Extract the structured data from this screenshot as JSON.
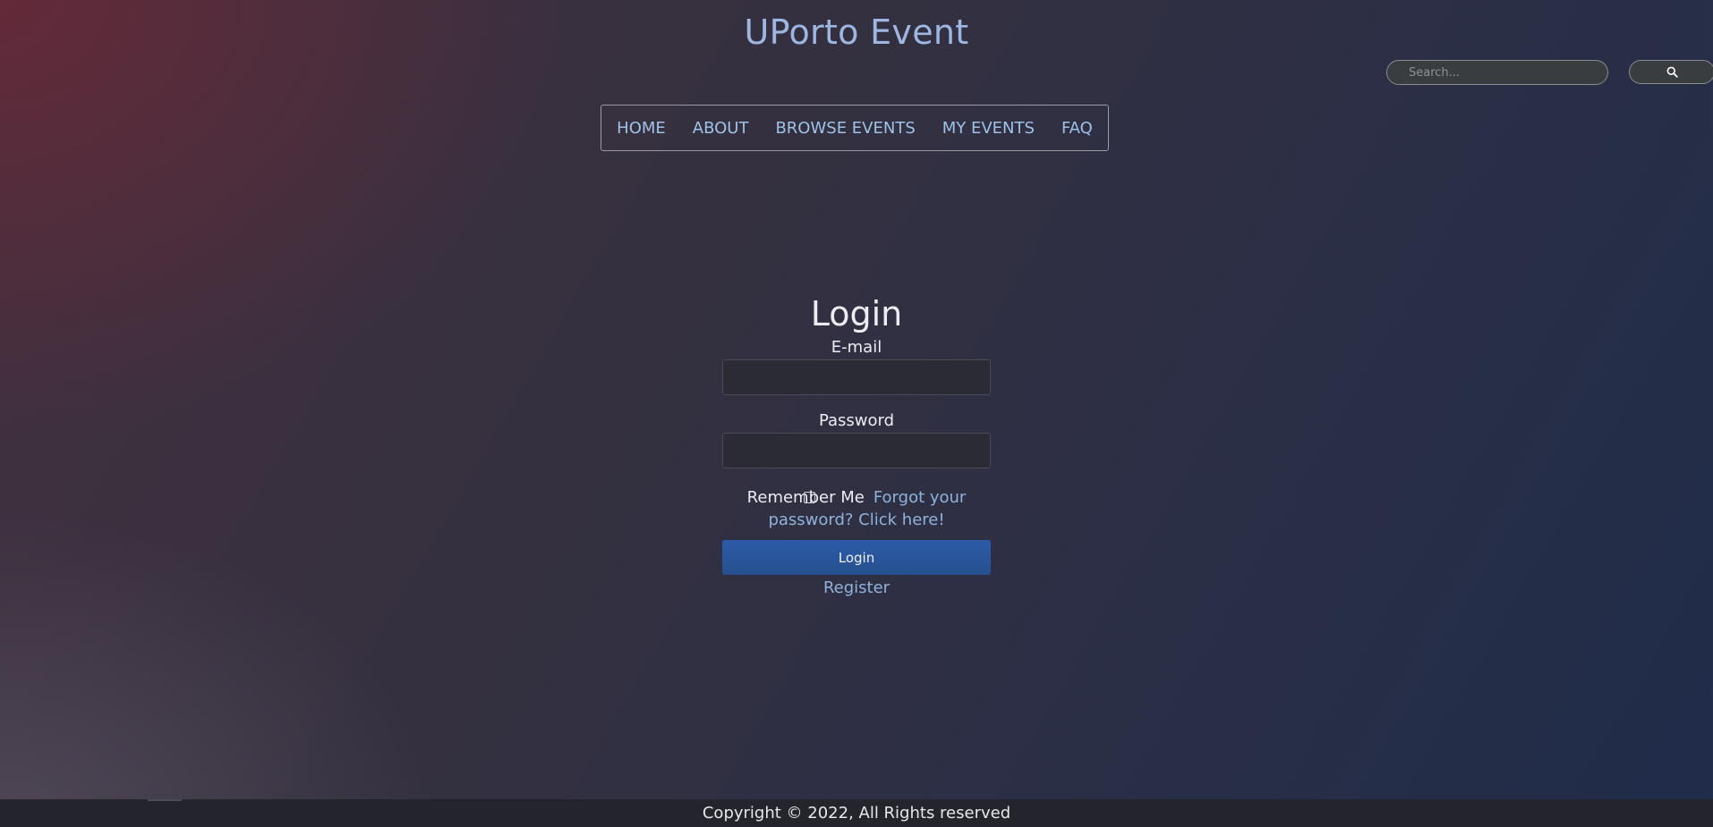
{
  "header": {
    "title": "UPorto Event"
  },
  "search": {
    "placeholder": "Search...",
    "icon": "search-icon"
  },
  "nav": {
    "items": [
      {
        "label": "HOME"
      },
      {
        "label": "ABOUT"
      },
      {
        "label": "BROWSE EVENTS"
      },
      {
        "label": "MY EVENTS"
      },
      {
        "label": "FAQ"
      }
    ]
  },
  "login": {
    "heading": "Login",
    "email_label": "E-mail",
    "email_value": "",
    "password_label": "Password",
    "password_value": "",
    "remember_checked": false,
    "remember_label": "Remember Me",
    "forgot_link": "Forgot your password? Click here!",
    "submit_label": "Login",
    "register_link": "Register"
  },
  "footer": {
    "copyright": "Copyright © 2022, All Rights reserved"
  },
  "colors": {
    "title": "#9db6e2",
    "nav_link": "#9fc2e8",
    "link": "#8fb2dc",
    "button": "#2c5aa8",
    "footer_bg": "#24252c"
  }
}
